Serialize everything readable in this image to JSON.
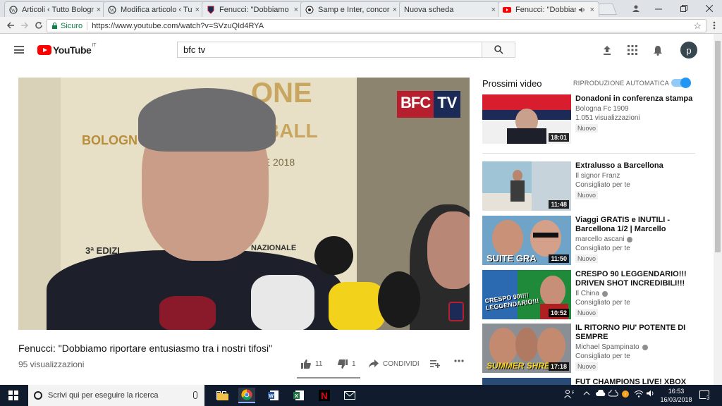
{
  "browser": {
    "tabs": [
      {
        "title": "Articoli ‹ Tutto Bologna",
        "favicon": "wordpress"
      },
      {
        "title": "Modifica articolo ‹ Tutto",
        "favicon": "wordpress"
      },
      {
        "title": "Fenucci: \"Dobbiamo rip",
        "favicon": "bfc"
      },
      {
        "title": "Samp e Inter, concorre",
        "favicon": "football"
      },
      {
        "title": "Nuova scheda",
        "favicon": "none"
      },
      {
        "title": "Fenucci: \"Dobbiame",
        "favicon": "youtube",
        "audio": true,
        "active": true
      }
    ],
    "close_glyph": "×",
    "secure_label": "Sicuro",
    "url": "https://www.youtube.com/watch?v=SVzuQId4RYA"
  },
  "youtube": {
    "logo_text": "YouTube",
    "country_code": "IT",
    "search_value": "bfc tv",
    "avatar_letter": "p"
  },
  "video": {
    "overlay_logo": [
      "BFC",
      "TV"
    ],
    "title": "Fenucci: \"Dobbiamo riportare entusiasmo tra i nostri tifosi\"",
    "views": "95 visualizzazioni",
    "likes": "11",
    "dislikes": "1",
    "share_label": "CONDIVIDI",
    "like_ratio": 0.92
  },
  "sidebar": {
    "title": "Prossimi video",
    "autoplay_label": "RIPRODUZIONE AUTOMATICA",
    "autoplay_on": true,
    "items": [
      {
        "title": "Donadoni in conferenza stampa",
        "channel": "Bologna Fc 1909",
        "verified": false,
        "sub": "1.051 visualizzazioni",
        "badge": "Nuovo",
        "duration": "18:01"
      },
      {
        "title": "Extralusso a Barcellona",
        "channel": "Il signor Franz",
        "verified": false,
        "sub": "Consigliato per te",
        "badge": "Nuovo",
        "duration": "11:48"
      },
      {
        "title": "Viaggi GRATIS e INUTILI - Barcellona 1/2 | Marcello",
        "channel": "marcello ascani",
        "verified": true,
        "sub": "Consigliato per te",
        "badge": "Nuovo",
        "duration": "11:50",
        "thumb_text": "SUITE GRA"
      },
      {
        "title": "CRESPO 90 LEGGENDARIO!!! DRIVEN SHOT INCREDIBILI!!!",
        "channel": "Il China",
        "verified": true,
        "sub": "Consigliato per te",
        "badge": "Nuovo",
        "duration": "10:52",
        "thumb_text": "CRESPO 90!!!! LEGGENDARIO!!!"
      },
      {
        "title": "IL RITORNO PIU' POTENTE DI SEMPRE",
        "channel": "Michael Spampinato",
        "verified": true,
        "sub": "Consigliato per te",
        "badge": "Nuovo",
        "duration": "17:18",
        "thumb_text": "SUMMER SHRED"
      },
      {
        "title": "FUT CHAMPIONS LIVE! XBOX",
        "channel": "",
        "verified": false,
        "sub": "",
        "badge": "",
        "duration": ""
      }
    ]
  },
  "taskbar": {
    "search_placeholder": "Scrivi qui per eseguire la ricerca",
    "time": "16:53",
    "date": "16/03/2018",
    "notification_count": "3"
  },
  "colors": {
    "youtube_red": "#ff0000",
    "bfc_red": "#b51f2e",
    "bfc_blue": "#1b2a56",
    "toggle_blue": "#2196f3",
    "taskbar": "#101b2d"
  }
}
